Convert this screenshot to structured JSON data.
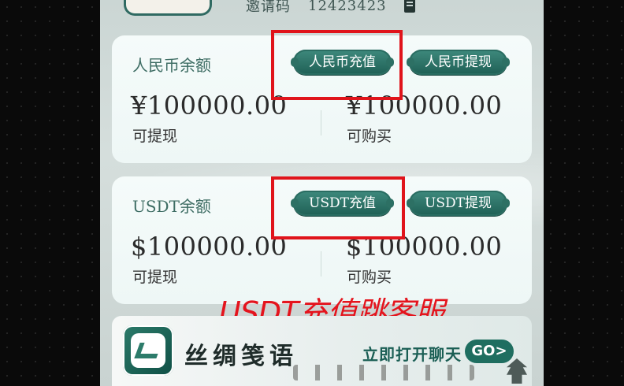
{
  "header": {
    "invite_label": "邀请码",
    "invite_code": "12423423"
  },
  "rmb_card": {
    "title": "人民币余额",
    "recharge_button": "人民币充值",
    "withdraw_button": "人民币提现",
    "withdrawable_amount": "¥100000.00",
    "withdrawable_label": "可提现",
    "purchasable_amount": "¥100000.00",
    "purchasable_label": "可购买"
  },
  "usdt_card": {
    "title": "USDT余额",
    "recharge_button": "USDT充值",
    "withdraw_button": "USDT提现",
    "withdrawable_amount": "$100000.00",
    "withdrawable_label": "可提现",
    "purchasable_amount": "$100000.00",
    "purchasable_label": "可购买"
  },
  "annotation": {
    "text": "USDT充值跳客服",
    "color": "#e4141d"
  },
  "banner": {
    "brand": "丝绸笺语",
    "cta": "立即打开聊天",
    "go_button": "GO>"
  },
  "colors": {
    "accent": "#1f5f55",
    "highlight_box": "#e0141b"
  }
}
